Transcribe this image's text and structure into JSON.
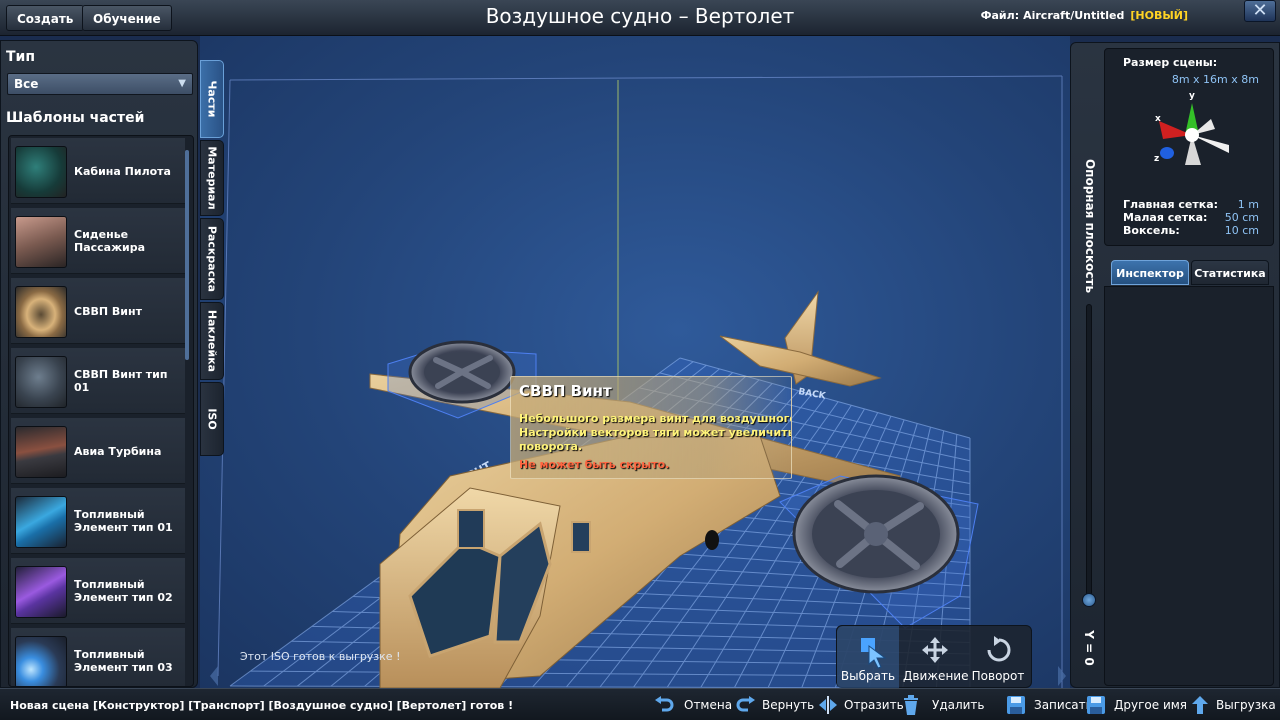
{
  "window": {
    "title": "Воздушное судно – Вертолет",
    "file_label": "Файл:",
    "file_path": "Aircraft/Untitled",
    "file_badge": "[НОВЫЙ]",
    "close_glyph": "✕"
  },
  "menu": {
    "create": "Создать",
    "tutorial": "Обучение"
  },
  "left_panel": {
    "type_label": "Тип",
    "type_value": "Все",
    "templates_label": "Шаблоны частей",
    "parts": [
      {
        "name": "Кабина Пилота",
        "icon": "cockpit-seat-icon"
      },
      {
        "name": "Сиденье Пассажира",
        "icon": "passenger-seat-icon"
      },
      {
        "name": "СВВП Винт",
        "icon": "vtol-rotor-icon"
      },
      {
        "name": "СВВП Винт тип 01",
        "icon": "vtol-rotor-type01-icon"
      },
      {
        "name": "Авиа Турбина",
        "icon": "turbine-icon"
      },
      {
        "name": "Топливный Элемент тип 01",
        "icon": "fuel-cell-01-icon"
      },
      {
        "name": "Топливный Элемент тип 02",
        "icon": "fuel-cell-02-icon"
      },
      {
        "name": "Топливный Элемент тип 03",
        "icon": "fuel-cell-03-icon"
      }
    ]
  },
  "side_tabs": [
    "Части",
    "Материал",
    "Раскраска",
    "Наклейка",
    "ISO"
  ],
  "right_panel": {
    "scene_size_label": "Размер сцены:",
    "scene_size_value": "8m x 16m x 8m",
    "axes": {
      "y": "y",
      "x": "x",
      "z": "z"
    },
    "grid": [
      {
        "label": "Главная сетка:",
        "value": "1 m"
      },
      {
        "label": "Малая сетка:",
        "value": "50 cm"
      },
      {
        "label": "Воксель:",
        "value": "10 cm"
      }
    ],
    "tabs": [
      "Инспектор",
      "Статистика"
    ],
    "reference_plane_label": "Опорная плоскость",
    "y_readout": "Y = 0"
  },
  "viewport": {
    "grid_labels": {
      "right": "RIGHT",
      "back": "BACK"
    },
    "iso_message": "Этот ISO готов к выгрузке !"
  },
  "tooltip": {
    "title": "СВВП Винт",
    "description": "Небольшого размера винт для воздушного судна. Настройки векторов тяги может увеличить скорость поворота.",
    "warning": "Не может быть скрыто."
  },
  "tools": [
    {
      "label": "Выбрать",
      "icon": "select-cursor-icon"
    },
    {
      "label": "Движение",
      "icon": "move-arrows-icon"
    },
    {
      "label": "Поворот",
      "icon": "rotate-icon"
    }
  ],
  "status_bar": {
    "text": "Новая сцена [Конструктор] [Транспорт] [Воздушное судно] [Вертолет] готов !",
    "undo": "Отмена",
    "redo": "Вернуть",
    "mirror": "Отразить",
    "delete": "Удалить",
    "save": "Записать",
    "save_as": "Другое имя",
    "export": "Выгрузка"
  },
  "colors": {
    "accent": "#3d73ad",
    "badge": "#ffd324",
    "value_blue": "#8fc3f5",
    "warning": "#ff6540",
    "tooltip_text": "#fff47a"
  }
}
